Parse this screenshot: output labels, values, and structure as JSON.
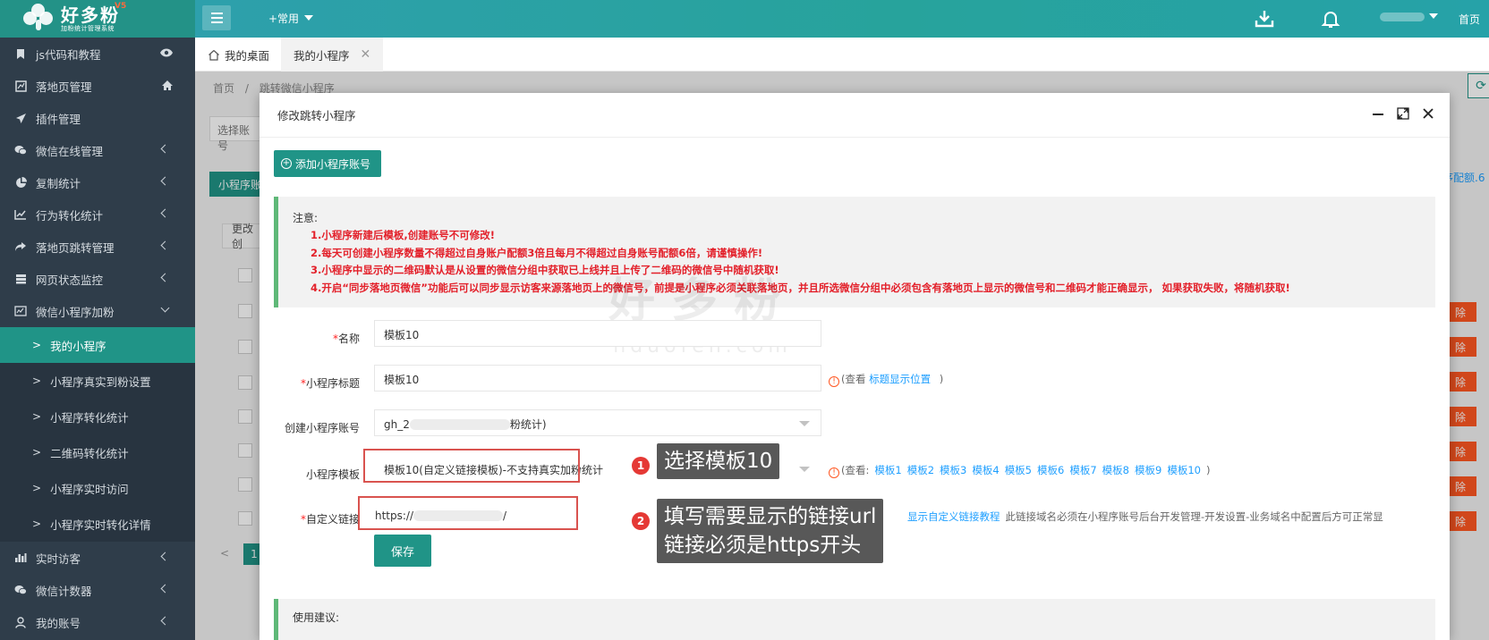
{
  "header": {
    "logo_title": "好多粉",
    "logo_subtitle": "加粉统计管理系统",
    "logo_version": "V5",
    "common_menu": "+常用",
    "home": "首页"
  },
  "sidebar": {
    "items": [
      {
        "label": "js代码和教程"
      },
      {
        "label": "落地页管理"
      },
      {
        "label": "插件管理"
      },
      {
        "label": "微信在线管理"
      },
      {
        "label": "复制统计"
      },
      {
        "label": "行为转化统计"
      },
      {
        "label": "落地页跳转管理"
      },
      {
        "label": "网页状态监控"
      },
      {
        "label": "微信小程序加粉"
      }
    ],
    "sub_items": [
      {
        "label": "我的小程序"
      },
      {
        "label": "小程序真实到粉设置"
      },
      {
        "label": "小程序转化统计"
      },
      {
        "label": "二维码转化统计"
      },
      {
        "label": "小程序实时访问"
      },
      {
        "label": "小程序实时转化详情"
      }
    ],
    "bottom_items": [
      {
        "label": "实时访客"
      },
      {
        "label": "微信计数器"
      },
      {
        "label": "我的账号"
      }
    ]
  },
  "tabs": [
    {
      "label": "我的桌面"
    },
    {
      "label": "我的小程序"
    }
  ],
  "background": {
    "breadcrumb_home": "首页",
    "breadcrumb_sep": "/",
    "breadcrumb_current": "跳转微信小程序",
    "select_placeholder": "选择账号",
    "btn_account": "小程序账",
    "btn_change": "更改创",
    "right_text": "序配额.6",
    "delete_label": "除",
    "page_number": "1"
  },
  "modal": {
    "title": "修改跳转小程序",
    "add_button": "添加小程序账号",
    "notice_title": "注意:",
    "notice_lines": [
      "1.小程序新建后模板,创建账号不可修改!",
      "2.每天可创建小程序数量不得超过自身账户配额3倍且每月不得超过自身账号配额6倍，请谨慎操作!",
      "3.小程序中显示的二维码默认是从设置的微信分组中获取已上线并且上传了二维码的微信号中随机获取!",
      "4.开启“同步落地页微信”功能后可以同步显示访客来源落地页上的微信号，前提是小程序必须关联落地页，并且所选微信分组中必须包含有落地页上显示的微信号和二维码才能正确显示， 如果获取失败，将随机获取!"
    ],
    "form": {
      "name_label": "名称",
      "name_value": "模板10",
      "title_label": "小程序标题",
      "title_value": "模板10",
      "title_hint_prefix": "(查看 ",
      "title_hint_link": "标题显示位置",
      "title_hint_suffix": " )",
      "account_label": "创建小程序账号",
      "account_value_start": "gh_2",
      "account_value_end": "粉统计)",
      "template_label": "小程序模板",
      "template_value": "模板10(自定义链接模板)-不支持真实加粉统计",
      "template_hint_prefix": "(查看:",
      "template_links": [
        "模板1",
        "模板2",
        "模板3",
        "模板4",
        "模板5",
        "模板6",
        "模板7",
        "模板8",
        "模板9",
        "模板10"
      ],
      "template_hint_suffix": ")",
      "link_label": "自定义链接",
      "link_value_start": "https://",
      "link_value_end": "/",
      "link_hint_link": "显示自定义链接教程",
      "link_hint_text": "此链接域名必须在小程序账号后台开发管理-开发设置-业务域名中配置后方可正常显",
      "save_button": "保存"
    },
    "advice_title": "使用建议:"
  },
  "watermark": {
    "brand": "好多粉",
    "domain": "hduofen.com"
  },
  "callouts": [
    {
      "number": "1",
      "text": "选择模板10"
    },
    {
      "number": "2",
      "line1": "填写需要显示的链接url",
      "line2": "链接必须是https开头"
    }
  ],
  "colors": {
    "primary": "#209487",
    "sidebar_bg": "#2f3d4a",
    "notice_red": "#e3202a",
    "link_blue": "#1e9fff",
    "highlight_red": "#d9534f"
  }
}
